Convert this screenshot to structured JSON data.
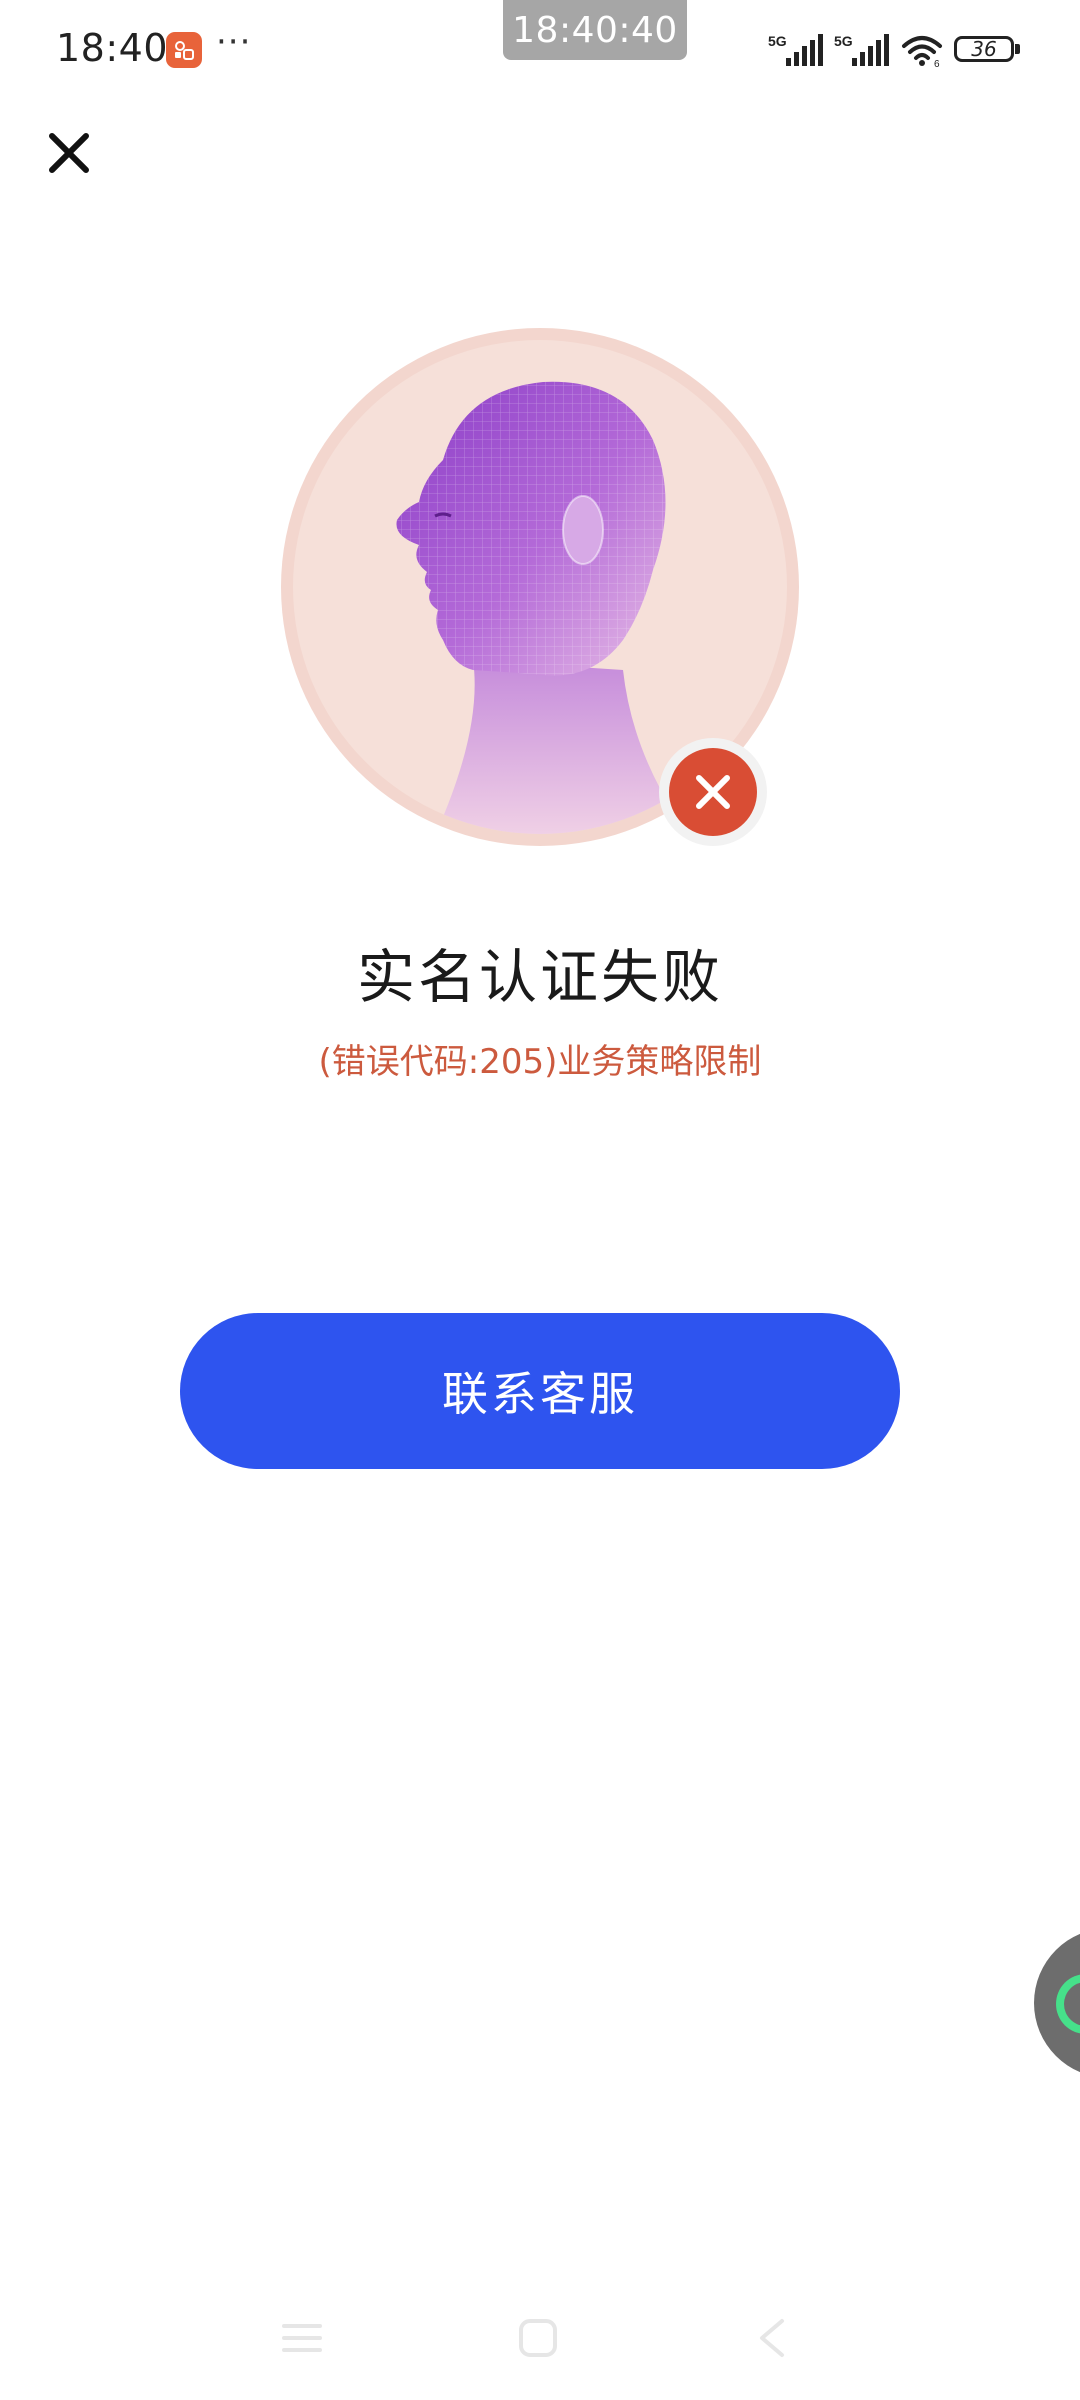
{
  "status_bar": {
    "time": "18:40",
    "more": "···",
    "clock_overlay": "18:40:40",
    "battery": "36"
  },
  "header": {
    "close_icon": "close-icon"
  },
  "result": {
    "avatar_icon": "face-scan-illustration",
    "badge_icon": "error-x-icon",
    "title": "实名认证失败",
    "error_message": "(错误代码:205)业务策略限制"
  },
  "actions": {
    "contact_label": "联系客服"
  },
  "nav_bar": {
    "icons": [
      "menu-icon",
      "home-icon",
      "back-icon"
    ]
  },
  "colors": {
    "primary_button": "#2e54ef",
    "error_text": "#cc5a3e",
    "error_badge": "#d94d34",
    "avatar_bg": "#f6e0d9"
  }
}
